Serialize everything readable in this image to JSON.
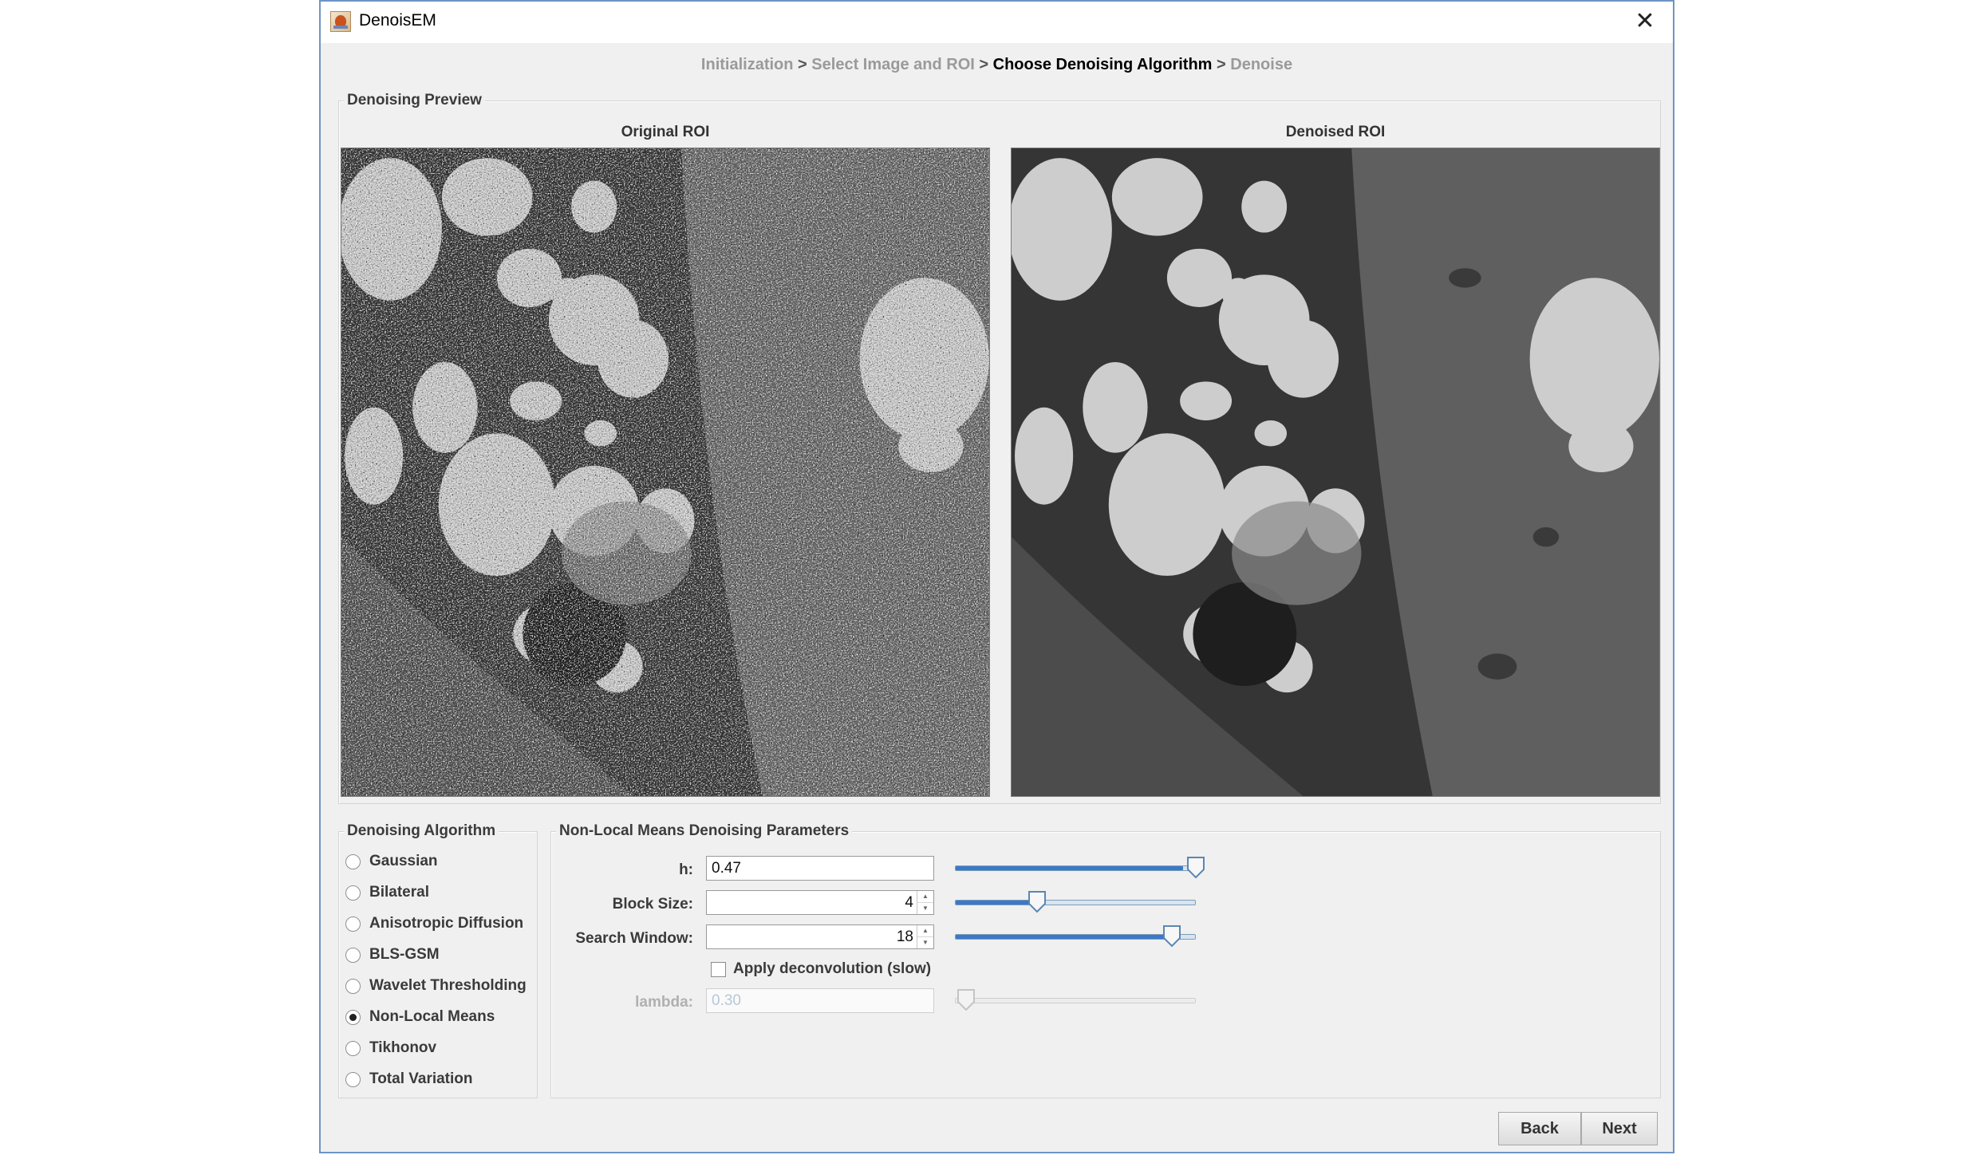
{
  "window": {
    "title": "DenoisEM"
  },
  "wizard": {
    "steps": [
      {
        "label": "Initialization",
        "state": "done"
      },
      {
        "label": "Select Image and ROI",
        "state": "done"
      },
      {
        "label": "Choose Denoising Algorithm",
        "state": "current"
      },
      {
        "label": "Denoise",
        "state": "upcoming"
      }
    ],
    "separator": ">"
  },
  "preview": {
    "title": "Denoising Preview",
    "original_title": "Original ROI",
    "denoised_title": "Denoised ROI"
  },
  "algorithms": {
    "title": "Denoising Algorithm",
    "options": [
      {
        "label": "Gaussian",
        "selected": false
      },
      {
        "label": "Bilateral",
        "selected": false
      },
      {
        "label": "Anisotropic Diffusion",
        "selected": false
      },
      {
        "label": "BLS-GSM",
        "selected": false
      },
      {
        "label": "Wavelet Thresholding",
        "selected": false
      },
      {
        "label": "Non-Local Means",
        "selected": true
      },
      {
        "label": "Tikhonov",
        "selected": false
      },
      {
        "label": "Total Variation",
        "selected": false
      }
    ]
  },
  "params": {
    "title": "Non-Local Means Denoising Parameters",
    "h": {
      "label": "h:",
      "value": "0.47",
      "slider_fraction": 0.95
    },
    "block_size": {
      "label": "Block Size:",
      "value": "4",
      "slider_fraction": 0.34
    },
    "search_window": {
      "label": "Search Window:",
      "value": "18",
      "slider_fraction": 0.9
    },
    "deconvolution": {
      "label": "Apply deconvolution (slow)",
      "checked": false
    },
    "lambda": {
      "label": "lambda:",
      "value": "0.30",
      "slider_fraction": 0.05,
      "enabled": false
    }
  },
  "buttons": {
    "back": "Back",
    "next": "Next"
  },
  "colors": {
    "window_border": "#6f94c4",
    "slider_accent": "#3b78c8",
    "panel_bg": "#f0f0f0"
  }
}
